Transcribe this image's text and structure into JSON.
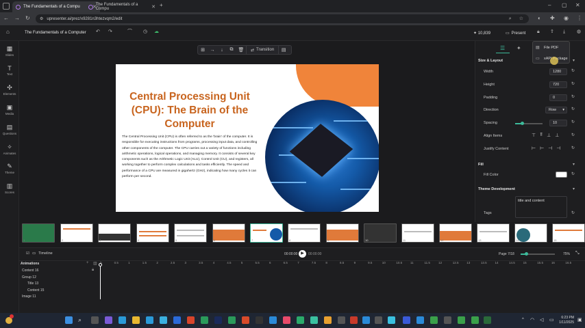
{
  "browser": {
    "tabs": [
      {
        "label": "The Fundamentals of a Compu",
        "active": true
      },
      {
        "label": "The Fundamentals of a Compu",
        "active": false
      }
    ],
    "url": "upresenter.ai/prez/x9281n3htezvqm2/edit"
  },
  "app": {
    "title": "The Fundamentals of a Computer",
    "credits": "10,839",
    "present_label": "Present"
  },
  "sidebar": {
    "items": [
      {
        "label": "Slides",
        "icon": "slides-icon"
      },
      {
        "label": "Text",
        "icon": "text-icon"
      },
      {
        "label": "Elements",
        "icon": "elements-icon"
      },
      {
        "label": "Media",
        "icon": "media-icon"
      },
      {
        "label": "Questions",
        "icon": "questions-icon"
      },
      {
        "label": "Animates",
        "icon": "animates-icon"
      },
      {
        "label": "Theme",
        "icon": "theme-icon"
      },
      {
        "label": "Scores",
        "icon": "scores-icon"
      }
    ]
  },
  "toolbar": {
    "transition_label": "Transition"
  },
  "slide": {
    "title": "Central Processing Unit (CPU): The Brain of the Computer",
    "body": "The Central Processing Unit (CPU) is often referred to as the 'brain' of the computer. It is responsible for executing instructions from programs, processing input data, and controlling other components of the computer. The CPU carries out a variety of functions including arithmetic operations, logical operations, and managing memory. It consists of several key components such as the Arithmetic Logic Unit (ALU), Control Unit (CU), and registers, all working together to perform complex calculations and tasks efficiently. The speed and performance of a CPU are measured in gigahertz (GHz), indicating how many cycles it can perform per second."
  },
  "export_menu": {
    "items": [
      "File PDF",
      "xAPI Package"
    ]
  },
  "properties": {
    "size_layout_label": "Size & Layout",
    "width_label": "Width",
    "width": "1280",
    "height_label": "Height",
    "height": "720",
    "padding_label": "Padding",
    "padding": "0",
    "direction_label": "Direction",
    "direction": "Row",
    "spacing_label": "Spacing",
    "spacing": "10",
    "align_label": "Align Items",
    "justify_label": "Justify Content",
    "fill_label": "Fill",
    "fill_color_label": "Fill Color",
    "theme_dev_label": "Theme Development",
    "tags_label": "Tags",
    "tags_value": "title and content"
  },
  "timeline": {
    "label": "Timeline",
    "time_current": "00:00:00",
    "time_total": "00:00:00",
    "page": "Page 7/18",
    "zoom": "75%",
    "animations_label": "Animations",
    "layers": [
      "Content 16",
      "Group 12",
      "Title 13",
      "Content 15",
      "Image 11"
    ],
    "ticks": [
      "0",
      "0.5",
      "1",
      "1.5",
      "2",
      "2.5",
      "3",
      "3.5",
      "4",
      "4.5",
      "5",
      "5.5",
      "6",
      "6.5",
      "7",
      "7.5",
      "8",
      "8.5",
      "9",
      "9.5",
      "10",
      "10.5",
      "11",
      "11.5",
      "12",
      "12.5",
      "13",
      "13.5",
      "14",
      "14.5",
      "15",
      "15.5",
      "16",
      "16.5"
    ]
  },
  "taskbar": {
    "time": "6:23 PM",
    "date": "1/11/2025"
  },
  "colors": {
    "accent": "#c8641e",
    "orange": "#f0843a"
  }
}
